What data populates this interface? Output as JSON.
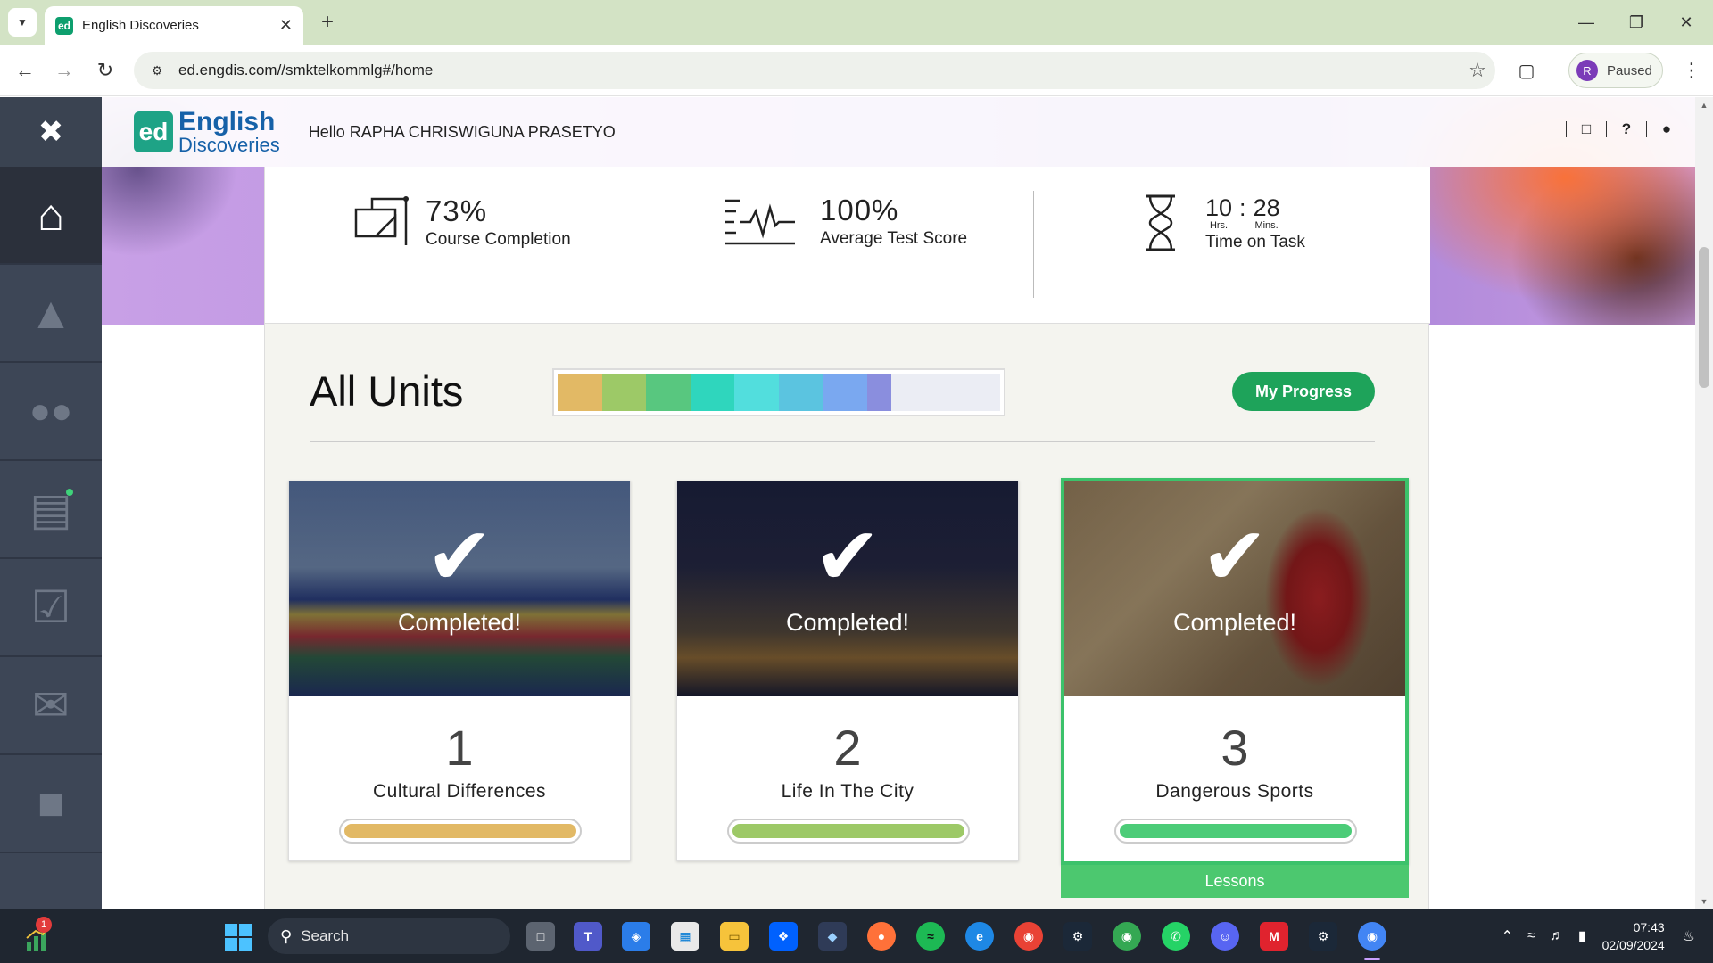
{
  "browser": {
    "tab_title": "English Discoveries",
    "tab_favicon": "ed",
    "url": "ed.engdis.com//smktelkommlg#/home",
    "profile_initial": "R",
    "profile_status": "Paused"
  },
  "header": {
    "logo_mark": "ed",
    "logo_line1": "English",
    "logo_line2": "Discoveries",
    "greeting": "Hello RAPHA CHRISWIGUNA PRASETYO"
  },
  "sidebar": {
    "items": [
      {
        "name": "home-icon"
      },
      {
        "name": "courses-icon"
      },
      {
        "name": "community-icon"
      },
      {
        "name": "assignments-icon"
      },
      {
        "name": "tests-icon"
      },
      {
        "name": "messages-icon"
      },
      {
        "name": "library-icon"
      }
    ]
  },
  "stats": {
    "completion_value": "73%",
    "completion_label": "Course Completion",
    "score_value": "100%",
    "score_label": "Average Test Score",
    "hours": "10",
    "separator": ":",
    "minutes": "28",
    "hours_unit": "Hrs.",
    "minutes_unit": "Mins.",
    "time_label": "Time on Task"
  },
  "units_header": {
    "title": "All Units",
    "progress_button": "My Progress",
    "segments": [
      {
        "color": "#e2b965",
        "fraction": 0.1
      },
      {
        "color": "#9dc967",
        "fraction": 0.1
      },
      {
        "color": "#58c77f",
        "fraction": 0.1
      },
      {
        "color": "#2fd6bd",
        "fraction": 0.1
      },
      {
        "color": "#52dedd",
        "fraction": 0.1
      },
      {
        "color": "#5bc4e0",
        "fraction": 0.1
      },
      {
        "color": "#7aa8f0",
        "fraction": 0.1
      },
      {
        "color": "#8a8ede",
        "fraction": 0.055
      },
      {
        "color": "#ebedf4",
        "fraction": 0.245
      }
    ]
  },
  "units": [
    {
      "number": "1",
      "name": "Cultural Differences",
      "status": "Completed!",
      "bar_color": "#e2b965",
      "progress": 1.0
    },
    {
      "number": "2",
      "name": "Life In The City",
      "status": "Completed!",
      "bar_color": "#9dc967",
      "progress": 1.0
    },
    {
      "number": "3",
      "name": "Dangerous Sports",
      "status": "Completed!",
      "bar_color": "#4ccc78",
      "progress": 1.0
    }
  ],
  "lessons_label": "Lessons",
  "taskbar": {
    "search_label": "Search",
    "weather_badge": "1",
    "time": "07:43",
    "date": "02/09/2024"
  }
}
